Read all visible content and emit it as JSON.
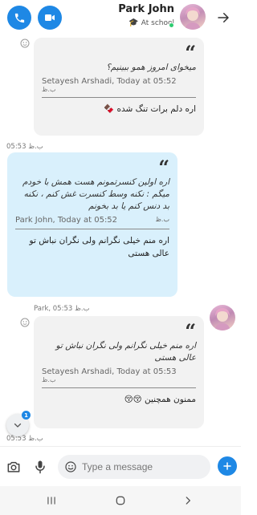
{
  "header": {
    "contact_name": "Park John",
    "status_text": "At school",
    "status_emoji": "🎓",
    "icons": {
      "call": "phone-icon",
      "video": "video-camera-icon",
      "forward": "arrow-right-icon"
    }
  },
  "messages": [
    {
      "direction": "incoming",
      "quote_text": "میخوای امروز همو ببینیم؟",
      "quote_author_time": "Setayesh Arshadi, Today at 05:52",
      "quote_suffix": "ب.ظ",
      "reply": "اره دلم برات تنگ شده 🍫",
      "time": "05:53 ب.ظ"
    },
    {
      "direction": "outgoing",
      "quote_text": "اره اولین کنسرتمونم هست همش با خودم میگم : نکنه وسط کنسرت غش کنم ، نکنه بد دنس کنم یا بد بخونم",
      "quote_author_time": "Park John, Today at 05:52",
      "quote_suffix": "ب.ظ",
      "reply": "اره منم خیلی نگرانم ولی نگران نباش تو عالی هستی"
    },
    {
      "direction": "incoming",
      "sender_time": "Park, 05:53 ب.ظ",
      "quote_text": "اره منم خیلی نگرانم ولی نگران نباش تو عالی هستی",
      "quote_author_time": "Setayesh Arshadi, Today at 05:53",
      "quote_suffix": "ب.ظ",
      "reply": "ممنون همچنین 😚😚",
      "time": "05:53 ب.ظ"
    }
  ],
  "scroll_down": {
    "badge_count": "1"
  },
  "composer": {
    "placeholder": "Type a message"
  },
  "colors": {
    "accent": "#1e88e5",
    "incoming_bubble": "#f2f2f2",
    "outgoing_bubble": "#d9f0fc",
    "online": "#2ecc71"
  }
}
